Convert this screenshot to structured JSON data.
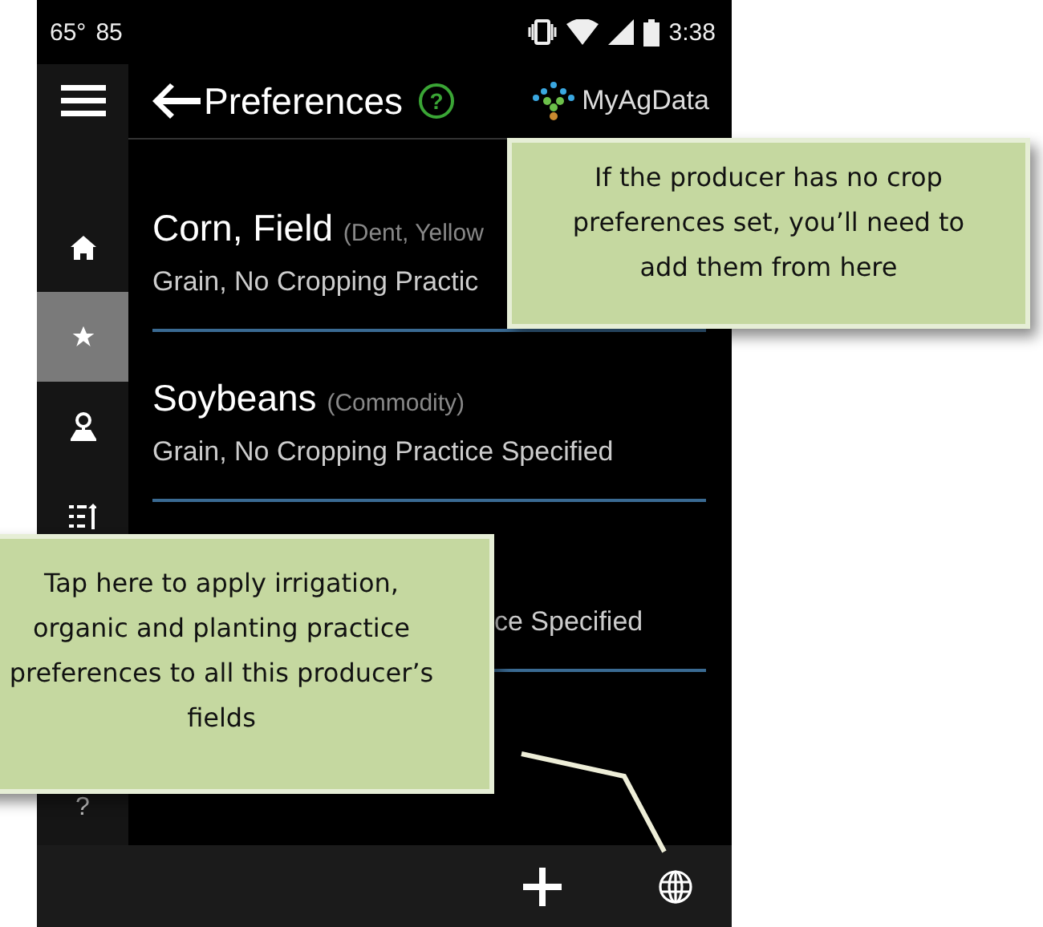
{
  "status_bar": {
    "temperature": "65°",
    "reading": "85",
    "time": "3:38"
  },
  "sidebar": {
    "items": [
      {
        "kind": "home",
        "selected": false
      },
      {
        "kind": "star",
        "selected": true
      },
      {
        "kind": "pin",
        "selected": false
      },
      {
        "kind": "list",
        "selected": false
      }
    ],
    "help": "?"
  },
  "header": {
    "title": "Preferences",
    "help": "?",
    "logo": "MyAgData"
  },
  "crops": [
    {
      "title": "Corn, Field",
      "detail": "(Dent, Yellow",
      "subtitle": "Grain, No Cropping Practic"
    },
    {
      "title": "Soybeans",
      "detail": "(Commodity)",
      "subtitle": "Grain, No Cropping Practice Specified"
    },
    {
      "subtitle": "ce Specified"
    }
  ],
  "callouts": [
    {
      "text": "If the producer has no crop preferences set, you’ll need to add them from here"
    },
    {
      "text": "Tap here to apply irrigation, organic and planting practice preferences to all this producer’s fields"
    }
  ]
}
